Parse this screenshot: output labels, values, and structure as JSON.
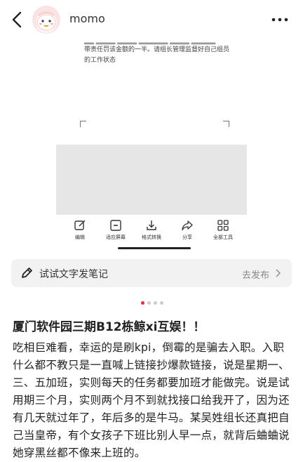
{
  "header": {
    "username": "momo"
  },
  "media": {
    "doc_lines": [
      "带责任罚该金额的一半。请组长管理监督好自己组员",
      "的工作状态"
    ],
    "toolbar": [
      {
        "icon": "edit-icon",
        "label": "编辑"
      },
      {
        "icon": "fit-screen-icon",
        "label": "适应屏幕"
      },
      {
        "icon": "download-icon",
        "label": "格式转换"
      },
      {
        "icon": "share-icon",
        "label": "分享"
      },
      {
        "icon": "grid-icon",
        "label": "全部工具"
      }
    ]
  },
  "note_bar": {
    "placeholder": "试试文字发笔记",
    "action": "去发布"
  },
  "pagination": {
    "total": 4,
    "current": 1
  },
  "post": {
    "title": "厦门软件园三期B12栋鲸xi互娱！！",
    "body": "吃相巨难看，幸运的是刷kpi，倒霉的是骗去入职。入职什么都不教只是一直喊上链接抄爆款链接，说是星期一、三、五加班，实则每天的任务都要加班才能做完。说是试用期三个月，实则两个月不到就找接口给我开了，因为还有几天就过年了，年后多的是牛马。某吴姓组长还真把自己当皇帝，有个女孩子下班比别人早一点，就背后蛐蛐说她穿黑丝都不像来上班的。"
  },
  "colors": {
    "accent": "#ff2442",
    "note_bar_bg": "#f2f2f2",
    "media_placeholder": "#e6e6e6"
  }
}
